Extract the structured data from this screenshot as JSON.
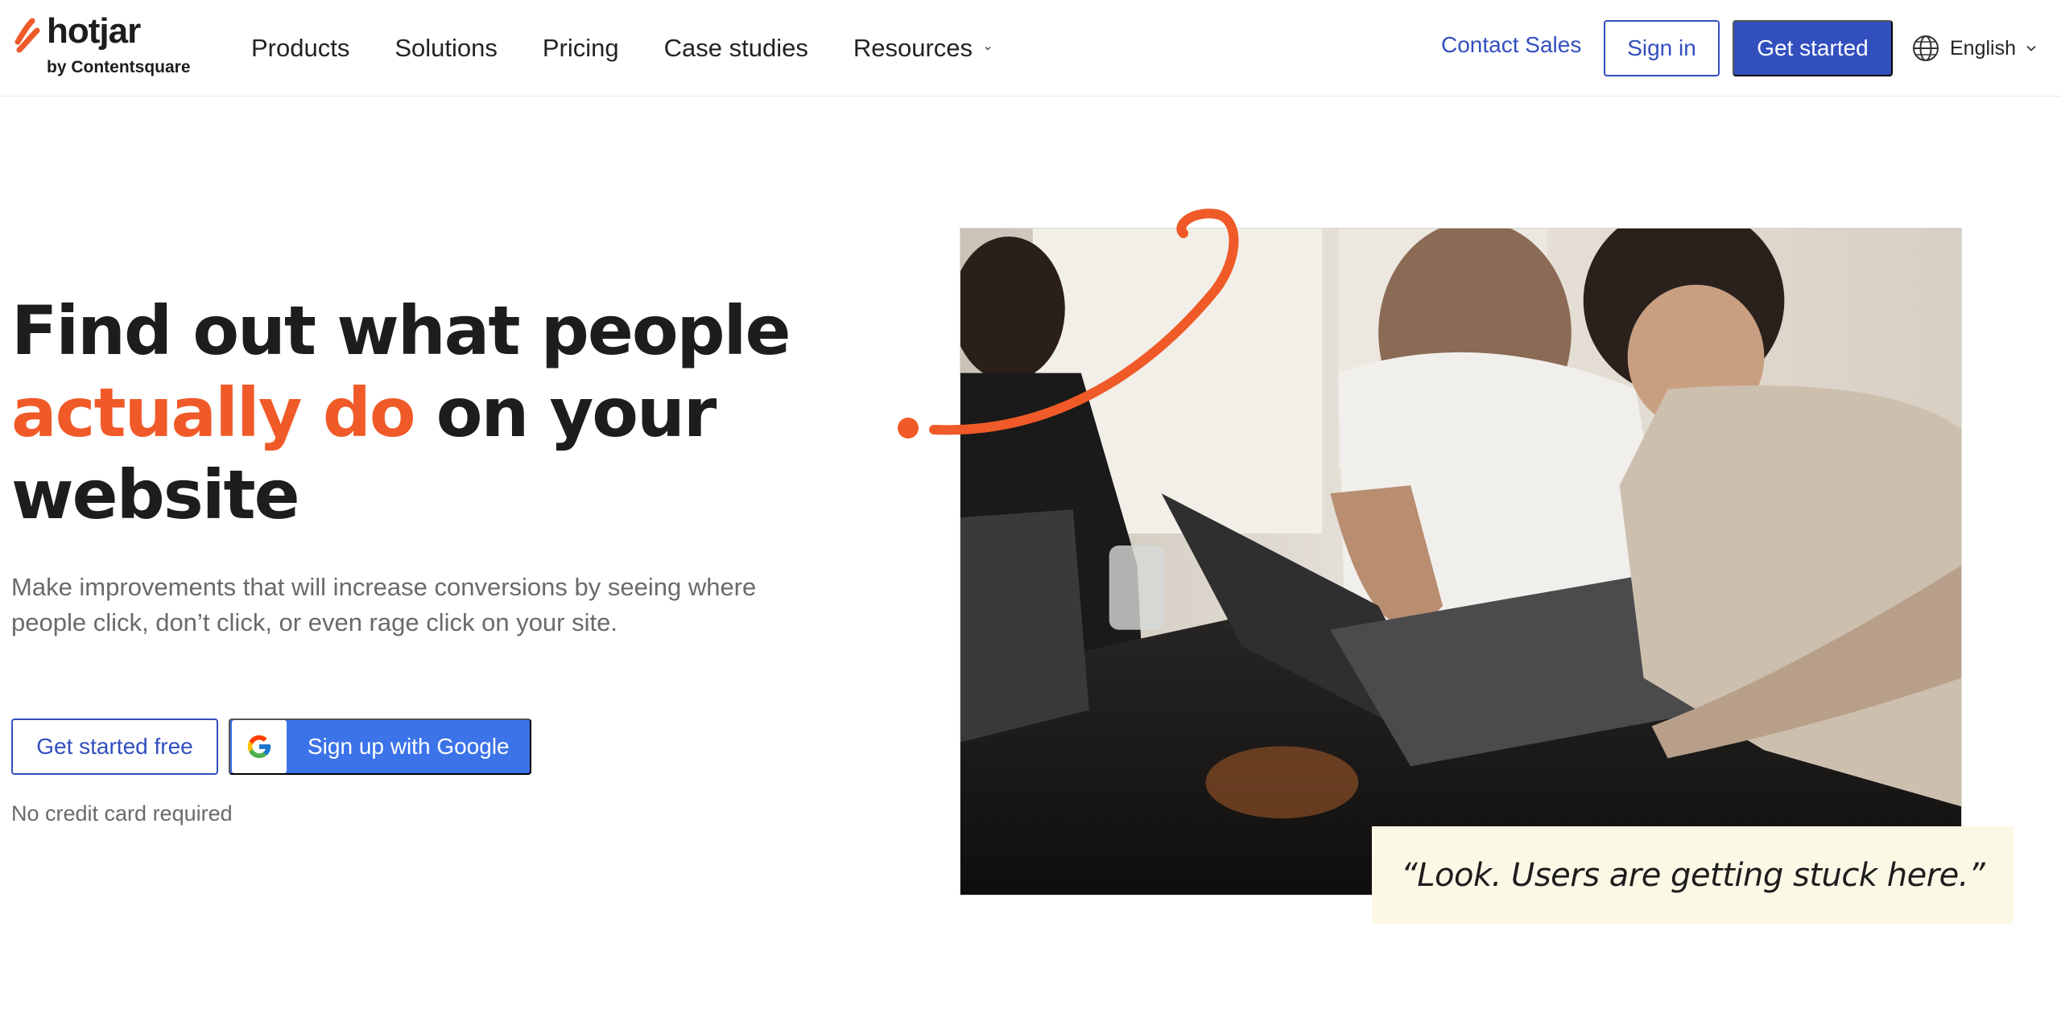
{
  "brand": {
    "name": "hotjar",
    "tagline": "by Contentsquare",
    "accent_color": "#f05a28",
    "primary_color": "#324fbe"
  },
  "nav": {
    "items": [
      {
        "label": "Products"
      },
      {
        "label": "Solutions"
      },
      {
        "label": "Pricing"
      },
      {
        "label": "Case studies"
      },
      {
        "label": "Resources",
        "has_dropdown": true
      }
    ],
    "contact_sales": "Contact Sales",
    "sign_in": "Sign in",
    "get_started": "Get started",
    "language": "English",
    "language_icon": "globe-icon"
  },
  "hero": {
    "headline_part1": "Find out what people",
    "headline_accent": "actually do",
    "headline_part2": "on your",
    "headline_part3": "website",
    "subtext": "Make improvements that will increase conversions by seeing where people click, don’t click, or even rage click on your site.",
    "cta_free": "Get started free",
    "cta_google": "Sign up with Google",
    "cta_google_icon": "google-icon",
    "no_credit_card": "No credit card required",
    "quote": "“Look. Users are getting stuck here.”",
    "google_button_color": "#3c73e8",
    "quote_background": "#fbf8e6"
  }
}
